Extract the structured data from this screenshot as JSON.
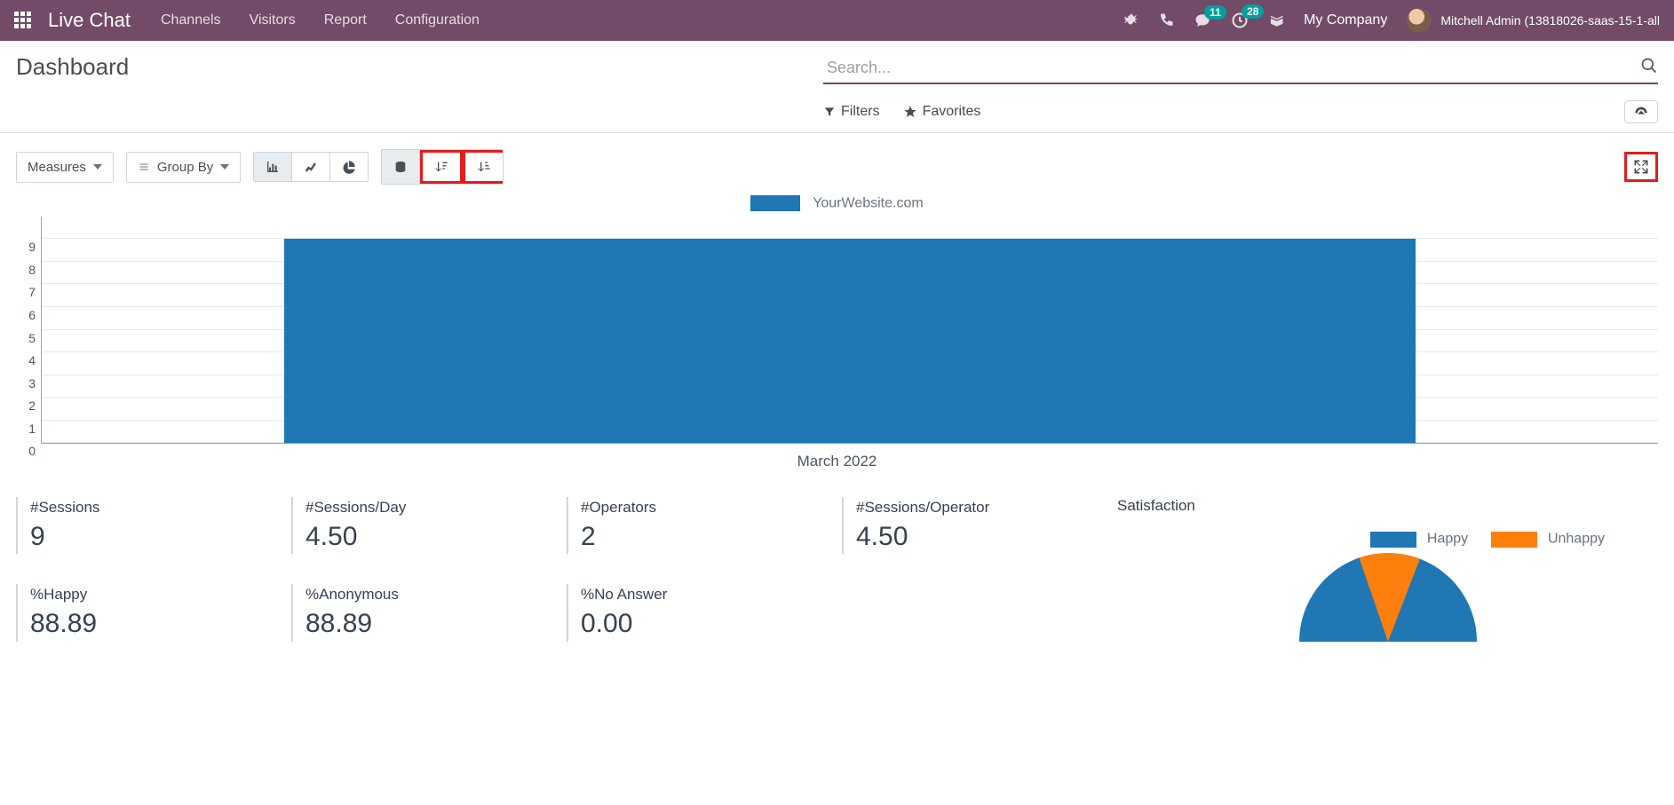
{
  "nav": {
    "brand": "Live Chat",
    "links": [
      "Channels",
      "Visitors",
      "Report",
      "Configuration"
    ],
    "messages_badge": "11",
    "activities_badge": "28",
    "company": "My Company",
    "user": "Mitchell Admin (13818026-saas-15-1-all"
  },
  "control_panel": {
    "title": "Dashboard",
    "search_placeholder": "Search...",
    "filters_label": "Filters",
    "favorites_label": "Favorites"
  },
  "toolbar": {
    "measures_label": "Measures",
    "groupby_label": "Group By"
  },
  "chart_data": {
    "type": "bar",
    "legend_series": "YourWebsite.com",
    "categories": [
      "March 2022"
    ],
    "values": [
      9
    ],
    "y_ticks": [
      0,
      1,
      2,
      3,
      4,
      5,
      6,
      7,
      8,
      9
    ],
    "ylim": [
      0,
      9
    ],
    "series_color": "#1f77b4"
  },
  "stats": {
    "row1": [
      {
        "label": "#Sessions",
        "value": "9"
      },
      {
        "label": "#Sessions/Day",
        "value": "4.50"
      },
      {
        "label": "#Operators",
        "value": "2"
      },
      {
        "label": "#Sessions/Operator",
        "value": "4.50"
      }
    ],
    "row2": [
      {
        "label": "%Happy",
        "value": "88.89"
      },
      {
        "label": "%Anonymous",
        "value": "88.89"
      },
      {
        "label": "%No Answer",
        "value": "0.00"
      }
    ]
  },
  "satisfaction": {
    "title": "Satisfaction",
    "series": [
      {
        "name": "Happy",
        "color": "#1f77b4",
        "value": 88.89
      },
      {
        "name": "Unhappy",
        "color": "#ff7f0e",
        "value": 11.11
      }
    ]
  }
}
